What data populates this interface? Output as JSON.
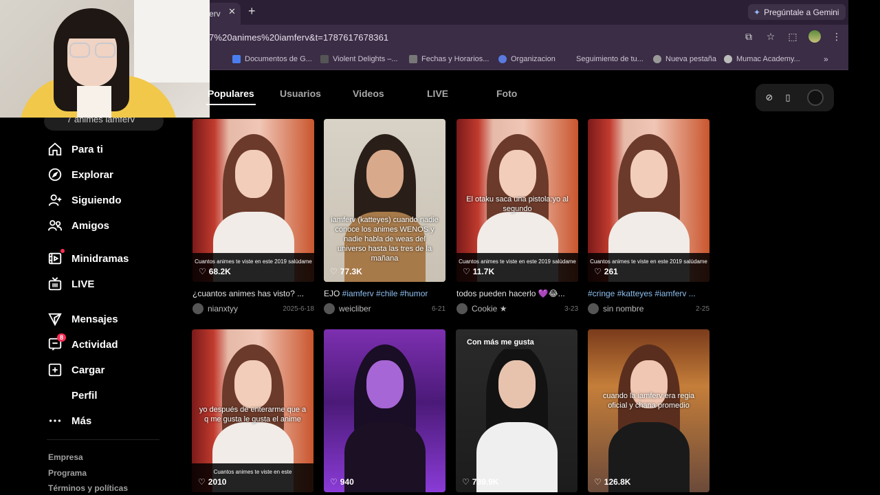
{
  "browser": {
    "tab_title": "erv",
    "gemini_label": "Pregúntale a Gemini",
    "url": "7%20animes%20iamferv&t=1787617678361",
    "bookmarks": [
      {
        "label": "Documentos de G...",
        "color": "#4a7ef0"
      },
      {
        "label": "Violent Delights –...",
        "color": "#444"
      },
      {
        "label": "Fechas y Horarios...",
        "color": "#666"
      },
      {
        "label": "Organizacion",
        "color": "#5a7ae0"
      },
      {
        "label": "Seguimiento de tu...",
        "color": "#3a2d45"
      },
      {
        "label": "Nueva pestaña",
        "color": "#888"
      },
      {
        "label": "Mumac Academy...",
        "color": "#aaa"
      }
    ]
  },
  "sidebar": {
    "search_text": "7 animes iamferv",
    "nav": [
      {
        "label": "Para ti",
        "icon": "home-icon"
      },
      {
        "label": "Explorar",
        "icon": "compass-icon"
      },
      {
        "label": "Siguiendo",
        "icon": "following-icon"
      },
      {
        "label": "Amigos",
        "icon": "friends-icon"
      },
      {
        "label": "Minidramas",
        "icon": "film-icon"
      },
      {
        "label": "LIVE",
        "icon": "live-tv-icon"
      },
      {
        "label": "Mensajes",
        "icon": "send-icon"
      },
      {
        "label": "Actividad",
        "icon": "activity-icon",
        "badge": "8"
      },
      {
        "label": "Cargar",
        "icon": "upload-icon"
      },
      {
        "label": "Perfil",
        "icon": ""
      },
      {
        "label": "Más",
        "icon": "more-icon"
      }
    ],
    "footer": [
      "Empresa",
      "Programa",
      "Términos y políticas"
    ]
  },
  "tabs": [
    "Populares",
    "Usuarios",
    "Videos",
    "LIVE",
    "Foto"
  ],
  "videos": [
    {
      "views": "68.2K",
      "desc_plain": "¿cuantos animes has visto? ...",
      "desc_tag": "",
      "author": "nianxtyy",
      "date": "2025-6-18",
      "caption": "Cuantos animes te viste en este 2019 salúdame",
      "overlay": "",
      "badge": ""
    },
    {
      "views": "77.3K",
      "desc_plain": "EJO ",
      "desc_tag": "#iamferv #chile #humor",
      "author": "weicliber",
      "date": "6-21",
      "caption": "",
      "overlay": "iamferv (katteyes) cuando nadie conoce los animes WENOS y nadie habla de weas del universo hasta las tres de la mañana",
      "badge": ""
    },
    {
      "views": "11.7K",
      "desc_plain": "todos pueden hacerlo 💜😂...",
      "desc_tag": "",
      "author": "Cookie ★",
      "date": "3-23",
      "caption": "Cuantos animes te viste en este 2019 salúdame",
      "overlay": "El otaku saca una pistola:yo al segundo",
      "badge": ""
    },
    {
      "views": "261",
      "desc_plain": "",
      "desc_tag": "#cringe #katteyes #iamferv ...",
      "author": "sin nombre",
      "date": "2-25",
      "caption": "Cuantos animes te viste en este 2019 salúdame",
      "overlay": "",
      "badge": ""
    },
    {
      "views": "2010",
      "desc_plain": "",
      "desc_tag": "",
      "author": "",
      "date": "",
      "caption": "Cuantos animes te viste en este",
      "overlay": "yo después de enterarme que a q me gusta le gusta el anime",
      "badge": ""
    },
    {
      "views": "940",
      "desc_plain": "",
      "desc_tag": "",
      "author": "",
      "date": "",
      "caption": "",
      "overlay": "",
      "badge": ""
    },
    {
      "views": "739.9K",
      "desc_plain": "",
      "desc_tag": "",
      "author": "",
      "date": "",
      "caption": "",
      "overlay": "",
      "badge": "Con más me gusta"
    },
    {
      "views": "126.8K",
      "desc_plain": "",
      "desc_tag": "",
      "author": "",
      "date": "",
      "caption": "",
      "overlay": "cuando la iamferv era regia oficial y chana promedio",
      "badge": ""
    }
  ],
  "colors": {
    "accent": "#fe2c55",
    "tag": "#8ec0f0",
    "browser_frame": "#3a2d45"
  }
}
